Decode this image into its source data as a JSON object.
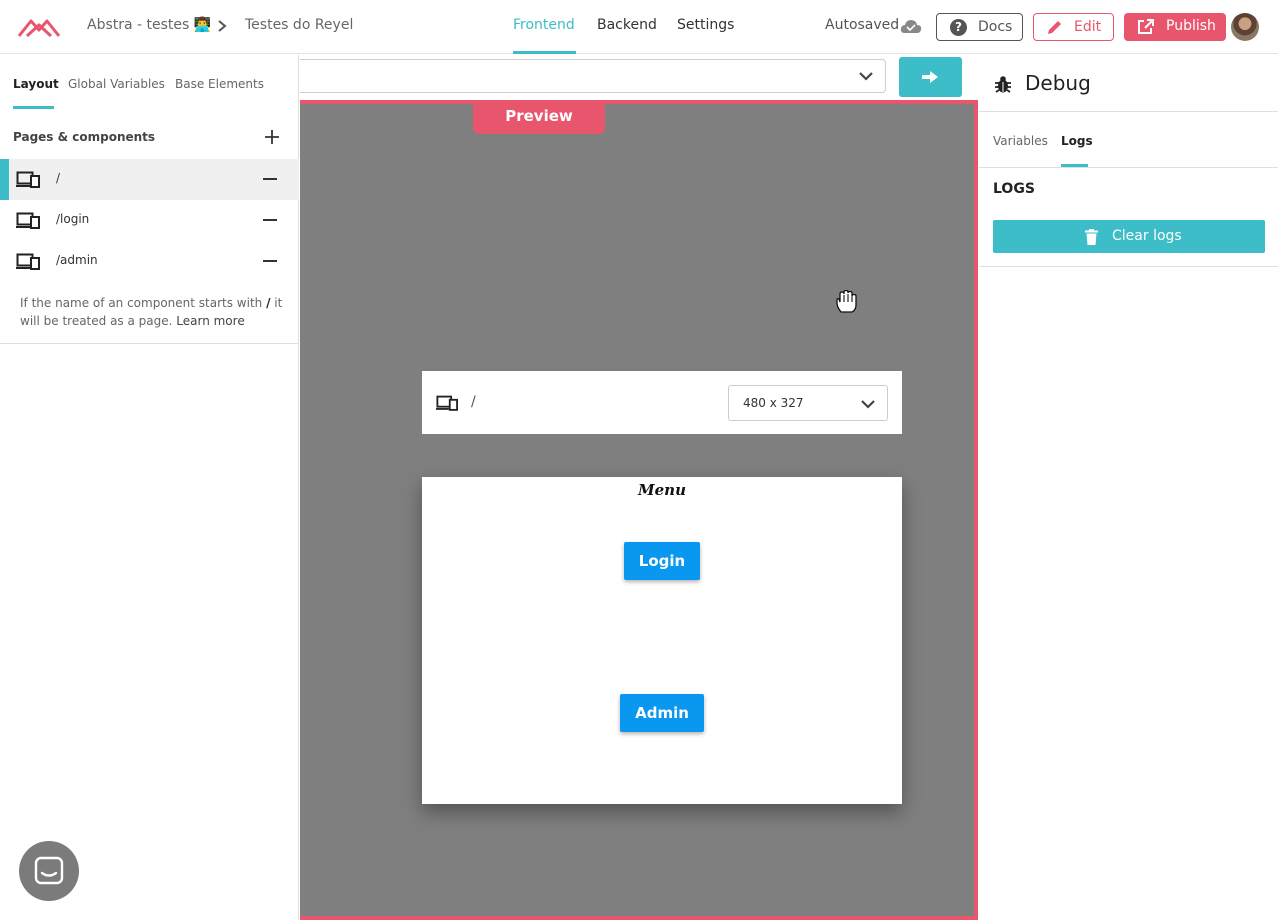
{
  "header": {
    "logo": "abstra-logo-icon",
    "project": "Abstra - testes 👨‍💻",
    "page": "Testes do Reyel",
    "tabs": [
      {
        "label": "Frontend",
        "active": true
      },
      {
        "label": "Backend",
        "active": false
      },
      {
        "label": "Settings",
        "active": false
      }
    ],
    "autosaved": "Autosaved",
    "docs_label": "Docs",
    "edit_label": "Edit",
    "publish_label": "Publish"
  },
  "sidebar": {
    "tabs": [
      {
        "label": "Layout",
        "active": true
      },
      {
        "label": "Global Variables",
        "active": false
      },
      {
        "label": "Base Elements",
        "active": false
      }
    ],
    "section_title": "Pages & components",
    "pages": [
      {
        "path": "/",
        "selected": true
      },
      {
        "path": "/login",
        "selected": false
      },
      {
        "path": "/admin",
        "selected": false
      }
    ],
    "hint_before": "If the name of an component starts with ",
    "hint_slash": "/",
    "hint_after": " it will be treated as a page. ",
    "hint_link": "Learn more"
  },
  "center": {
    "url_value": "",
    "preview_label": "Preview",
    "device_path": "/",
    "size_value": "480 x 327",
    "frame": {
      "menu_title": "Menu",
      "login_label": "Login",
      "admin_label": "Admin"
    }
  },
  "debug": {
    "title": "Debug",
    "tabs": [
      {
        "label": "Variables",
        "active": false
      },
      {
        "label": "Logs",
        "active": true
      }
    ],
    "logs_heading": "LOGS",
    "clear_label": "Clear logs"
  },
  "colors": {
    "accent": "#3cbdc8",
    "brand": "#e8566e",
    "button_blue": "#0a97f0"
  }
}
